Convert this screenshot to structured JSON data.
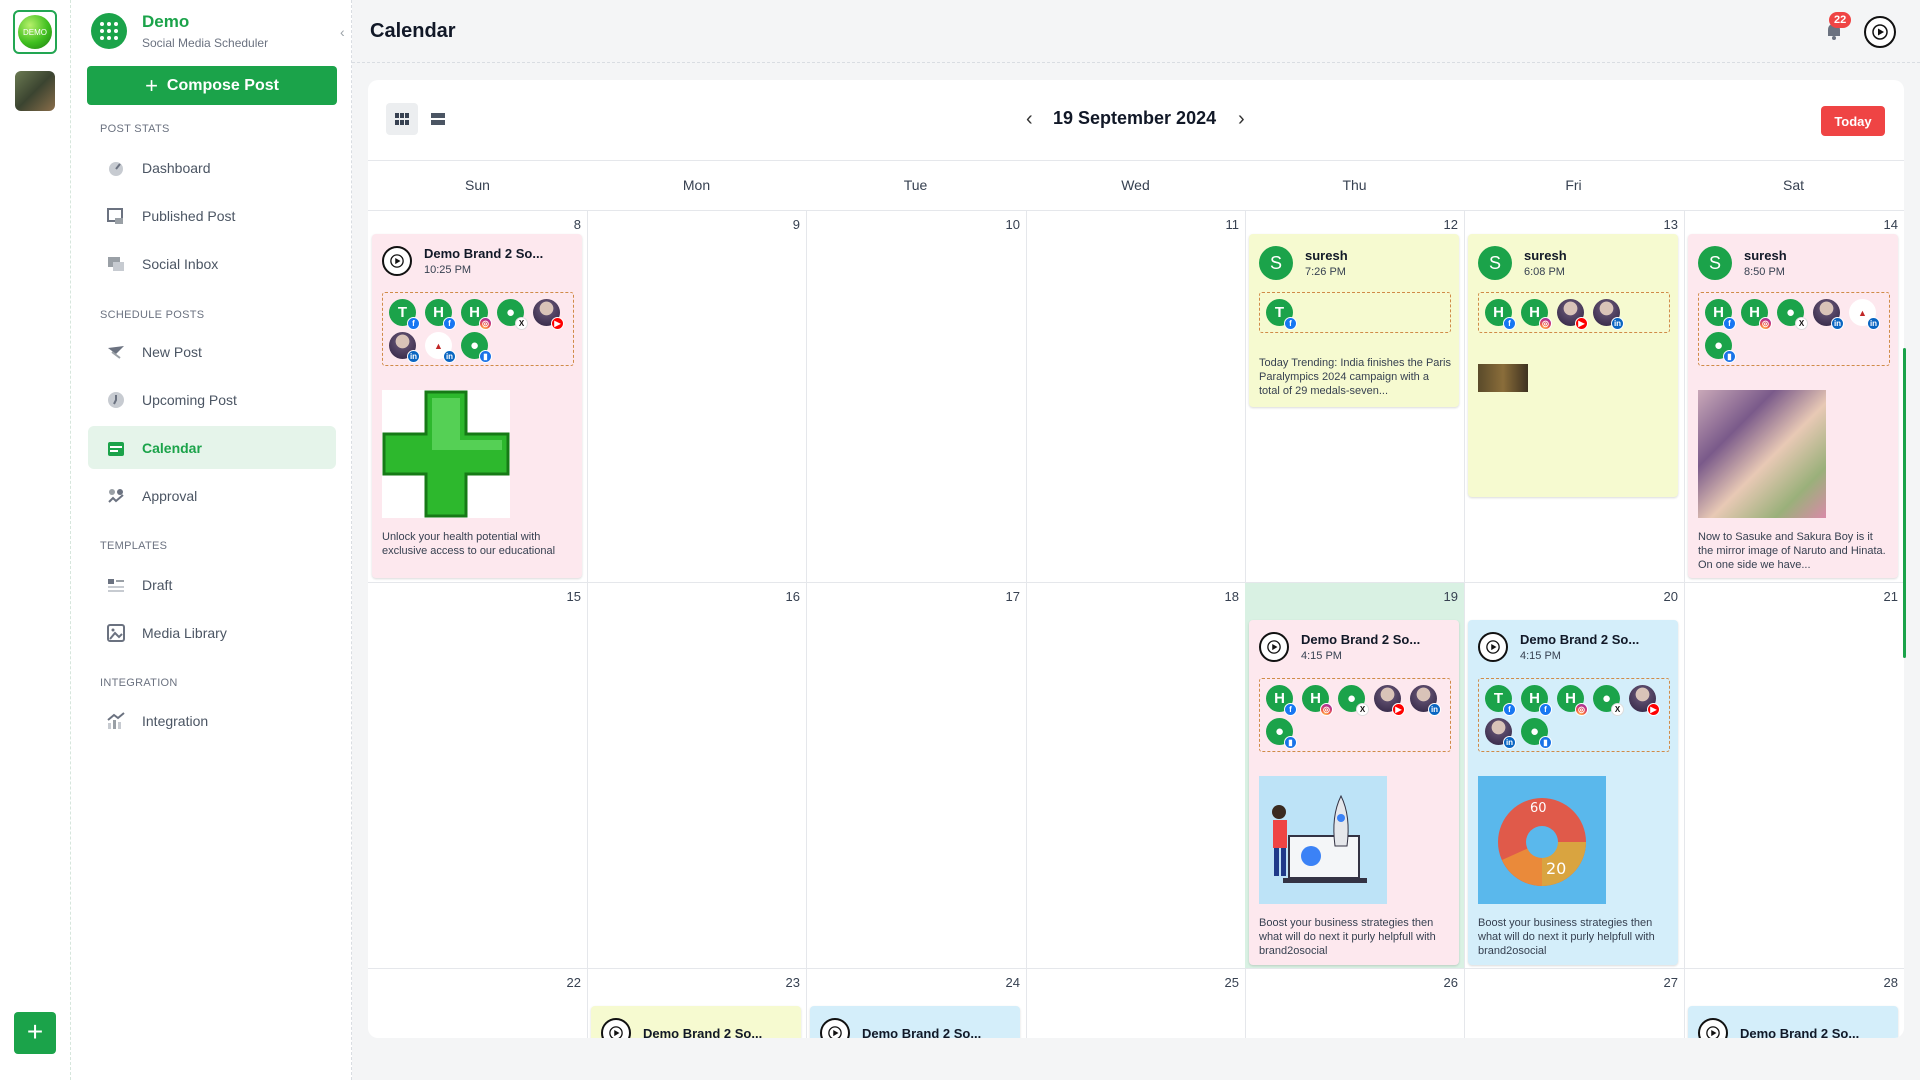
{
  "rail": {
    "workspace_label": "DEMO",
    "add_label": "+"
  },
  "brand": {
    "name": "Demo",
    "subtitle": "Social Media Scheduler"
  },
  "compose": {
    "plus": "+",
    "label": "Compose Post"
  },
  "sections": {
    "post_stats": "POST STATS",
    "schedule_posts": "SCHEDULE POSTS",
    "templates": "TEMPLATES",
    "integration": "INTEGRATION"
  },
  "nav": {
    "dashboard": "Dashboard",
    "published": "Published Post",
    "inbox": "Social Inbox",
    "new_post": "New Post",
    "upcoming": "Upcoming Post",
    "calendar": "Calendar",
    "approval": "Approval",
    "draft": "Draft",
    "media": "Media Library",
    "integration": "Integration"
  },
  "header": {
    "title": "Calendar",
    "notifications": "22"
  },
  "calendar": {
    "current_date": "19 September 2024",
    "today_label": "Today",
    "days": [
      "Sun",
      "Mon",
      "Tue",
      "Wed",
      "Thu",
      "Fri",
      "Sat"
    ],
    "weeks": [
      [
        "8",
        "9",
        "10",
        "11",
        "12",
        "13",
        "14"
      ],
      [
        "15",
        "16",
        "17",
        "18",
        "19",
        "20",
        "21"
      ],
      [
        "22",
        "23",
        "24",
        "25",
        "26",
        "27",
        "28"
      ]
    ]
  },
  "posts": {
    "p8": {
      "name": "Demo Brand 2 So...",
      "time": "10:25 PM",
      "text": "Unlock your health potential with exclusive access to our educational"
    },
    "p12": {
      "name": "suresh",
      "time": "7:26 PM",
      "text": "Today Trending: India finishes the Paris Paralympics 2024 campaign with a total of 29 medals-seven..."
    },
    "p13": {
      "name": "suresh",
      "time": "6:08 PM"
    },
    "p14": {
      "name": "suresh",
      "time": "8:50 PM",
      "text": "Now to Sasuke and Sakura Boy is it the mirror image of Naruto and Hinata. On one side we have..."
    },
    "p19": {
      "name": "Demo Brand 2 So...",
      "time": "4:15 PM",
      "text": "Boost your business strategies then what will do next it purly helpfull with brand2osocial"
    },
    "p20": {
      "name": "Demo Brand 2 So...",
      "time": "4:15 PM",
      "text": "Boost your business strategies then what will do next it purly helpfull with brand2osocial"
    },
    "p23": {
      "name": "Demo Brand 2 So..."
    },
    "p24": {
      "name": "Demo Brand 2 So..."
    },
    "p28": {
      "name": "Demo Brand 2 So..."
    }
  },
  "account_letters": {
    "t": "T",
    "h": "H",
    "s": "S"
  },
  "image_labels": {
    "pie_a": "60",
    "pie_b": "20"
  },
  "colors": {
    "brand_green": "#1ba34a",
    "today_red": "#ef4444",
    "pink_post": "#fde8ee",
    "yellow_post": "#f6fad0",
    "blue_post": "#d4eefa"
  }
}
